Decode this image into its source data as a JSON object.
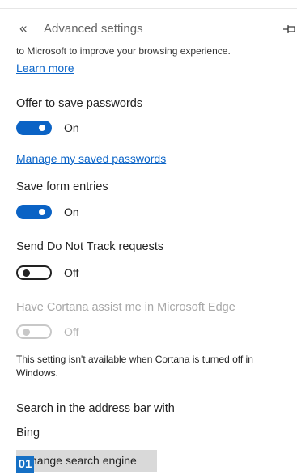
{
  "header": {
    "back_glyph": "«",
    "title": "Advanced settings",
    "pin_icon": "pin-icon"
  },
  "privacy": {
    "cut_text": "to Microsoft to improve your browsing experience.",
    "learn_more": "Learn more"
  },
  "passwords": {
    "label": "Offer to save passwords",
    "state": "On",
    "manage_link": "Manage my saved passwords"
  },
  "form_entries": {
    "label": "Save form entries",
    "state": "On"
  },
  "do_not_track": {
    "label": "Send Do Not Track requests",
    "state": "Off"
  },
  "cortana": {
    "label": "Have Cortana assist me in Microsoft Edge",
    "state": "Off",
    "note": "This setting isn't available when Cortana is turned off in Windows."
  },
  "search": {
    "label": "Search in the address bar with",
    "value": "Bing",
    "button_label": "hange search engine"
  },
  "badge": "01",
  "colors": {
    "toggle_on": "#0b63c5",
    "link": "#0a64c8",
    "badge": "#1670c5",
    "button_bg": "#d9d9d9",
    "disabled": "#c8c8c8"
  }
}
